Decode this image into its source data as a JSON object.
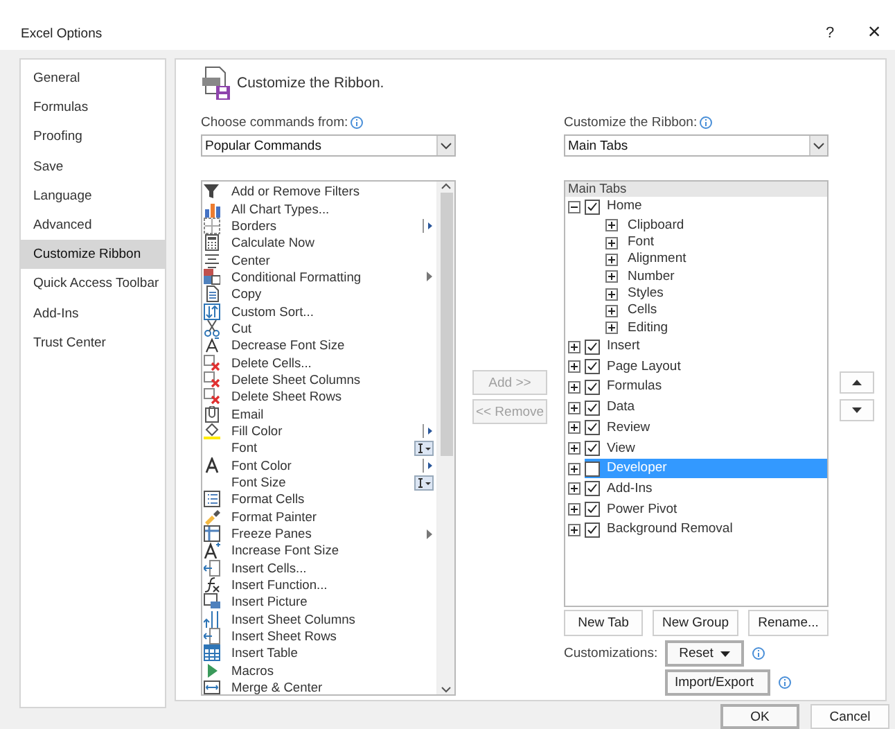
{
  "window": {
    "title": "Excel Options",
    "help": "?",
    "close": "×"
  },
  "sidebar": {
    "items": [
      {
        "label": "General",
        "selected": false
      },
      {
        "label": "Formulas",
        "selected": false
      },
      {
        "label": "Proofing",
        "selected": false
      },
      {
        "label": "Save",
        "selected": false
      },
      {
        "label": "Language",
        "selected": false
      },
      {
        "label": "Advanced",
        "selected": false
      },
      {
        "label": "Customize Ribbon",
        "selected": true
      },
      {
        "label": "Quick Access Toolbar",
        "selected": false
      },
      {
        "label": "Add-Ins",
        "selected": false
      },
      {
        "label": "Trust Center",
        "selected": false
      }
    ]
  },
  "header": {
    "title": "Customize the Ribbon."
  },
  "commands_source": {
    "label": "Choose commands from:",
    "value": "Popular Commands"
  },
  "ribbon_source": {
    "label": "Customize the Ribbon:",
    "value": "Main Tabs"
  },
  "commands": [
    {
      "label": "Add or Remove Filters",
      "kind": "plain"
    },
    {
      "label": "All Chart Types...",
      "kind": "plain"
    },
    {
      "label": "Borders",
      "kind": "split"
    },
    {
      "label": "Calculate Now",
      "kind": "plain"
    },
    {
      "label": "Center",
      "kind": "plain"
    },
    {
      "label": "Conditional Formatting",
      "kind": "menu"
    },
    {
      "label": "Copy",
      "kind": "plain"
    },
    {
      "label": "Custom Sort...",
      "kind": "plain"
    },
    {
      "label": "Cut",
      "kind": "plain"
    },
    {
      "label": "Decrease Font Size",
      "kind": "plain"
    },
    {
      "label": "Delete Cells...",
      "kind": "plain"
    },
    {
      "label": "Delete Sheet Columns",
      "kind": "plain"
    },
    {
      "label": "Delete Sheet Rows",
      "kind": "plain"
    },
    {
      "label": "Email",
      "kind": "plain"
    },
    {
      "label": "Fill Color",
      "kind": "split"
    },
    {
      "label": "Font",
      "kind": "combo"
    },
    {
      "label": "Font Color",
      "kind": "split"
    },
    {
      "label": "Font Size",
      "kind": "combo"
    },
    {
      "label": "Format Cells",
      "kind": "plain"
    },
    {
      "label": "Format Painter",
      "kind": "plain"
    },
    {
      "label": "Freeze Panes",
      "kind": "menu"
    },
    {
      "label": "Increase Font Size",
      "kind": "plain"
    },
    {
      "label": "Insert Cells...",
      "kind": "plain"
    },
    {
      "label": "Insert Function...",
      "kind": "plain"
    },
    {
      "label": "Insert Picture",
      "kind": "plain"
    },
    {
      "label": "Insert Sheet Columns",
      "kind": "plain"
    },
    {
      "label": "Insert Sheet Rows",
      "kind": "plain"
    },
    {
      "label": "Insert Table",
      "kind": "plain"
    },
    {
      "label": "Macros",
      "kind": "plain"
    },
    {
      "label": "Merge & Center",
      "kind": "plain"
    }
  ],
  "move_buttons": [
    {
      "label": "Add >>",
      "disabled": true
    },
    {
      "label": "<< Remove",
      "disabled": true
    }
  ],
  "ribbon_tree": {
    "header": "Main Tabs",
    "tabs": [
      {
        "label": "Home",
        "checked": true,
        "expanded": true,
        "selected": false,
        "children": [
          {
            "label": "Clipboard",
            "expanded": false
          },
          {
            "label": "Font",
            "expanded": false
          },
          {
            "label": "Alignment",
            "expanded": false
          },
          {
            "label": "Number",
            "expanded": false
          },
          {
            "label": "Styles",
            "expanded": false
          },
          {
            "label": "Cells",
            "expanded": false
          },
          {
            "label": "Editing",
            "expanded": false
          }
        ]
      },
      {
        "label": "Insert",
        "checked": true,
        "expanded": false,
        "selected": false
      },
      {
        "label": "Page Layout",
        "checked": true,
        "expanded": false,
        "selected": false
      },
      {
        "label": "Formulas",
        "checked": true,
        "expanded": false,
        "selected": false
      },
      {
        "label": "Data",
        "checked": true,
        "expanded": false,
        "selected": false
      },
      {
        "label": "Review",
        "checked": true,
        "expanded": false,
        "selected": false
      },
      {
        "label": "View",
        "checked": true,
        "expanded": false,
        "selected": false
      },
      {
        "label": "Developer",
        "checked": false,
        "expanded": false,
        "selected": true
      },
      {
        "label": "Add-Ins",
        "checked": true,
        "expanded": false,
        "selected": false
      },
      {
        "label": "Power Pivot",
        "checked": true,
        "expanded": false,
        "selected": false
      },
      {
        "label": "Background Removal",
        "checked": true,
        "expanded": false,
        "selected": false
      }
    ]
  },
  "tree_buttons": [
    "New Tab",
    "New Group",
    "Rename..."
  ],
  "customizations": {
    "label": "Customizations:",
    "reset": "Reset",
    "import_export": "Import/Export"
  },
  "footer": {
    "ok": "OK",
    "cancel": "Cancel"
  }
}
